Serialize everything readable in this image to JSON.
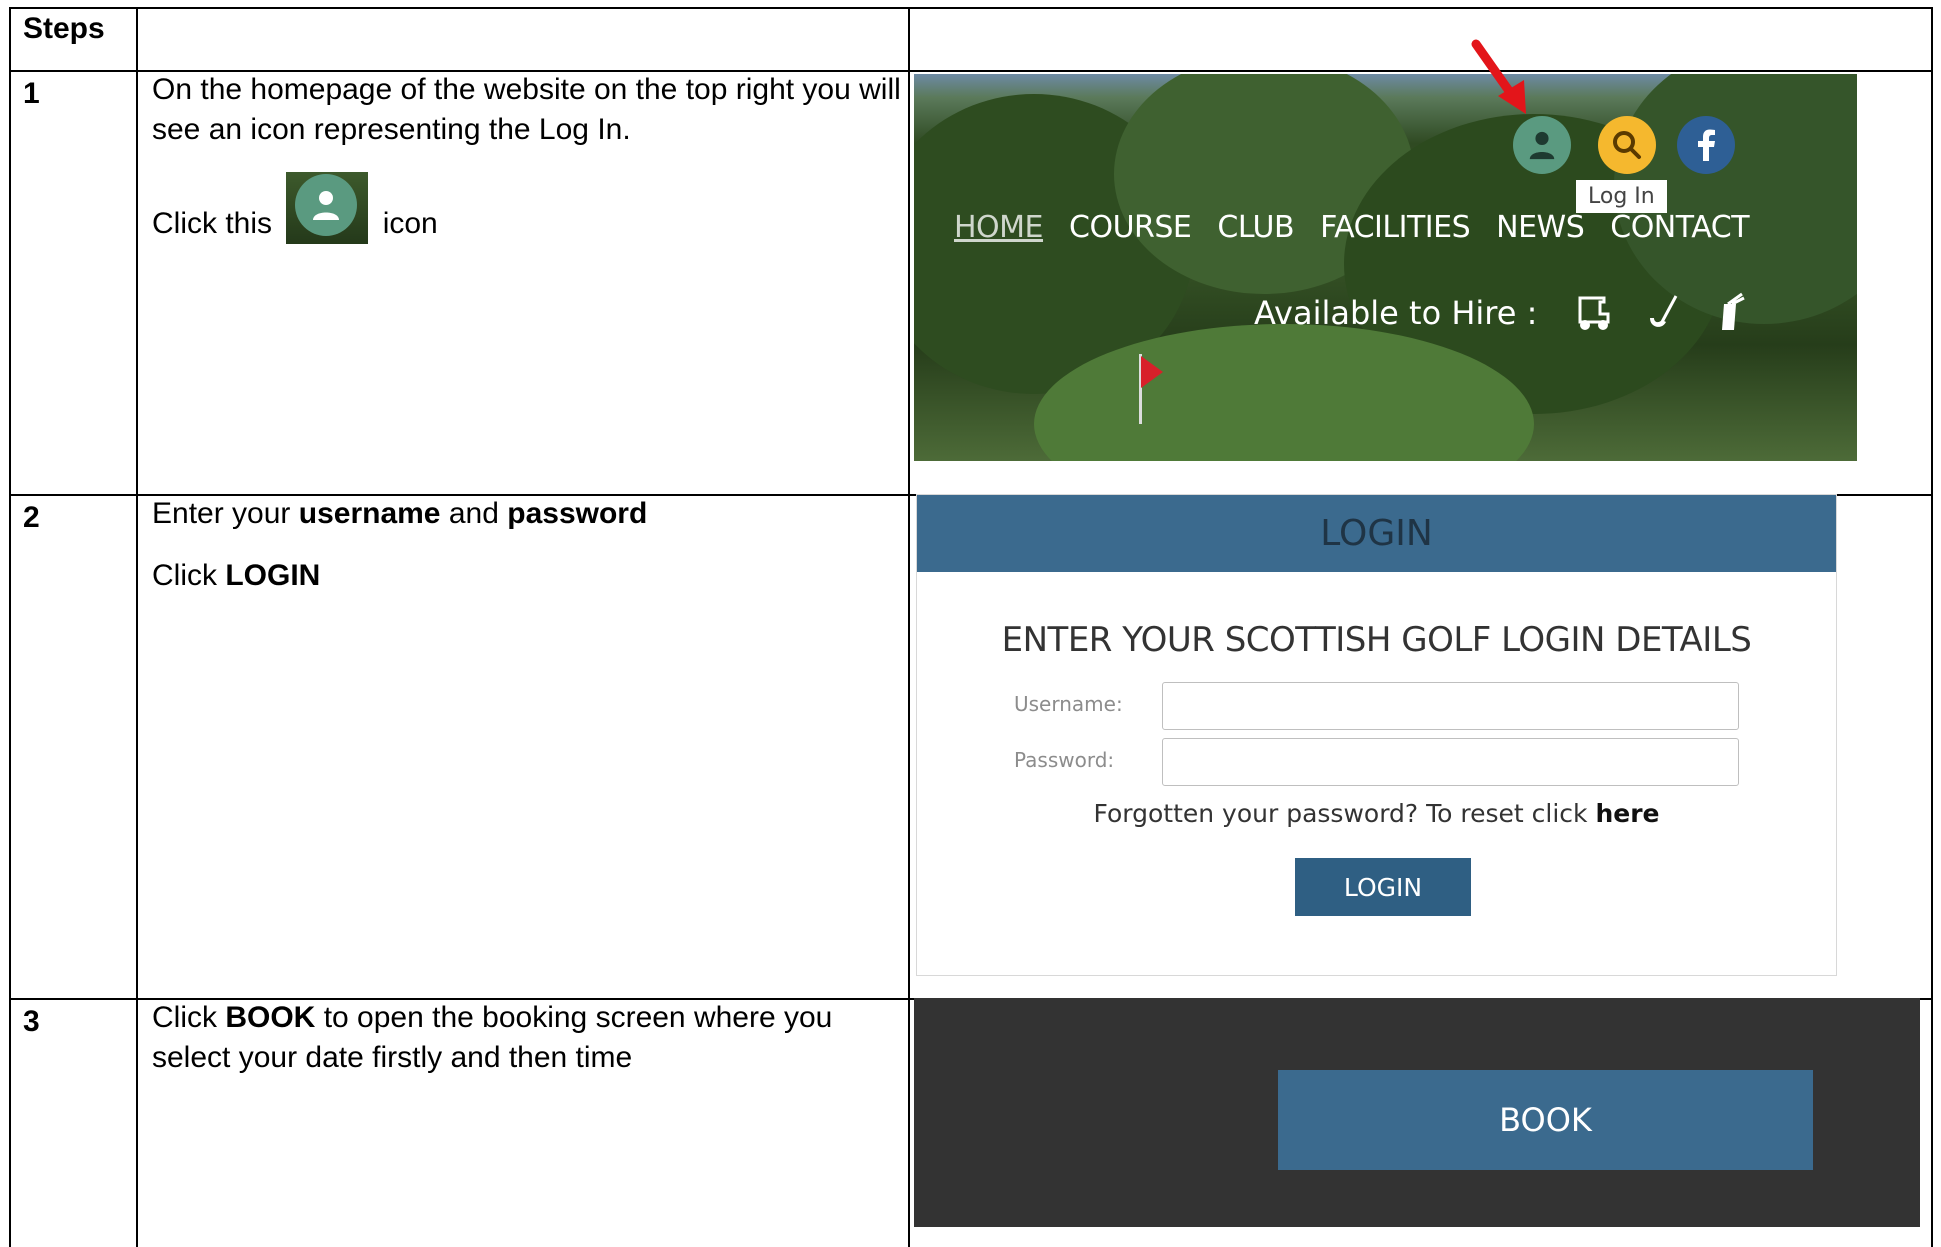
{
  "table": {
    "header": "Steps",
    "rows": [
      {
        "num": "1",
        "line1": "On the homepage of the website on the top right you will see an icon representing the Log In.",
        "click_prefix": "Click this",
        "click_suffix": "icon"
      },
      {
        "num": "2",
        "enter_prefix": "Enter your",
        "username": "username",
        "and": "and",
        "password": "password",
        "click_prefix": "Click",
        "click_target": "LOGIN"
      },
      {
        "num": "3",
        "click_prefix": "Click",
        "click_target": "BOOK",
        "rest": "to open the booking screen where you select your date firstly and then time"
      }
    ]
  },
  "shot1": {
    "nav": [
      "HOME",
      "COURSE",
      "CLUB",
      "FACILITIES",
      "NEWS",
      "CONTACT"
    ],
    "hire_label": "Available to Hire :",
    "tooltip": "Log In",
    "icons": [
      "user-icon",
      "search-icon",
      "facebook-icon",
      "golf-cart-icon",
      "golf-club-icon",
      "golf-bag-icon"
    ],
    "colors": {
      "user": "#5a9a80",
      "search": "#f5b82e",
      "facebook": "#2e5f95",
      "arrow": "#e3151a"
    }
  },
  "shot2": {
    "bar_title": "LOGIN",
    "heading": "ENTER YOUR SCOTTISH GOLF LOGIN DETAILS",
    "username_label": "Username:",
    "password_label": "Password:",
    "username_value": "",
    "password_value": "",
    "forgot_text": "Forgotten your password? To reset click",
    "forgot_link": "here",
    "button": "LOGIN",
    "colors": {
      "bar": "#3b6a8e",
      "button": "#2f5f83"
    }
  },
  "shot3": {
    "button": "BOOK",
    "colors": {
      "background": "#333333",
      "button": "#3b6a8e"
    }
  }
}
